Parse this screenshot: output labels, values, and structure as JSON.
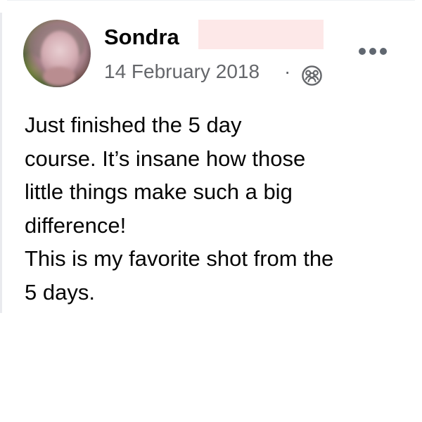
{
  "post": {
    "author_name": "Sondra",
    "date": "14 February 2018",
    "separator": "·",
    "audience_icon": "group-audience-icon",
    "more_icon": "more-options-icon",
    "lines": [
      "Just finished the 5 day",
      "course. It’s insane how those",
      "little things make such a big",
      "difference!",
      "This is my favorite shot from the",
      "5 days."
    ]
  },
  "colors": {
    "text_primary": "#050505",
    "text_secondary": "#65676b",
    "redaction": "#fde8e8",
    "more_dots": "#606770"
  }
}
